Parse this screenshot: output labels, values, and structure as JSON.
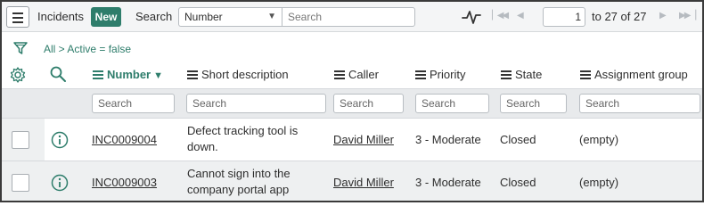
{
  "toolbar": {
    "title": "Incidents",
    "new_label": "New",
    "search_label": "Search",
    "search_field": "Number",
    "search_placeholder": "Search",
    "page_current": "1",
    "page_total_text": "to 27 of 27"
  },
  "filter": {
    "breadcrumb": "All > Active = false"
  },
  "columns": [
    {
      "label": "Number",
      "sorted": true,
      "search_placeholder": "Search"
    },
    {
      "label": "Short description",
      "search_placeholder": "Search"
    },
    {
      "label": "Caller",
      "search_placeholder": "Search"
    },
    {
      "label": "Priority",
      "search_placeholder": "Search"
    },
    {
      "label": "State",
      "search_placeholder": "Search"
    },
    {
      "label": "Assignment group",
      "search_placeholder": "Search"
    }
  ],
  "rows": [
    {
      "number": "INC0009004",
      "short_description": "Defect tracking tool is down.",
      "caller": "David Miller",
      "priority": "3 - Moderate",
      "state": "Closed",
      "assignment_group": "(empty)"
    },
    {
      "number": "INC0009003",
      "short_description": "Cannot sign into the company portal app",
      "caller": "David Miller",
      "priority": "3 - Moderate",
      "state": "Closed",
      "assignment_group": "(empty)"
    }
  ],
  "icons": {
    "menu": "hamburger-icon",
    "activity": "activity-stream-icon",
    "filter": "funnel-icon",
    "settings": "gear-icon",
    "search": "magnifier-icon",
    "preview": "info-icon",
    "pager_first": "first-page-icon",
    "pager_prev": "previous-page-icon",
    "pager_next": "next-page-icon",
    "pager_last": "last-page-icon"
  },
  "colors": {
    "accent": "#2e7d6b",
    "toolbar_bg": "#f4f5f6",
    "row_alt_bg": "#eef0f1"
  }
}
